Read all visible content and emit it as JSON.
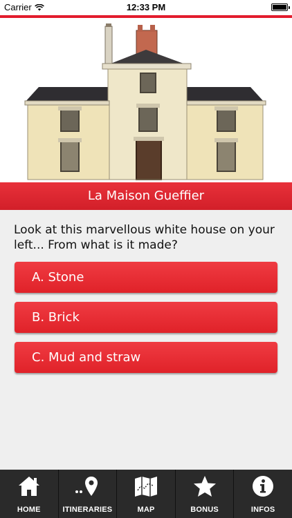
{
  "status_bar": {
    "carrier": "Carrier",
    "time": "12:33 PM"
  },
  "colors": {
    "accent": "#e21c2d",
    "button": "#e8262d",
    "tab_bar": "#2a2a2a"
  },
  "header": {
    "title": "La Maison Gueffier"
  },
  "quiz": {
    "question": "Look at this marvellous white house on your left... From what is it made?",
    "answers": [
      {
        "label": "A. Stone"
      },
      {
        "label": "B. Brick"
      },
      {
        "label": "C. Mud and straw"
      }
    ]
  },
  "tabs": [
    {
      "label": "HOME",
      "icon": "home-icon"
    },
    {
      "label": "ITINERARIES",
      "icon": "map-pin-icon"
    },
    {
      "label": "MAP",
      "icon": "map-icon"
    },
    {
      "label": "BONUS",
      "icon": "star-icon"
    },
    {
      "label": "INFOS",
      "icon": "info-icon"
    }
  ]
}
